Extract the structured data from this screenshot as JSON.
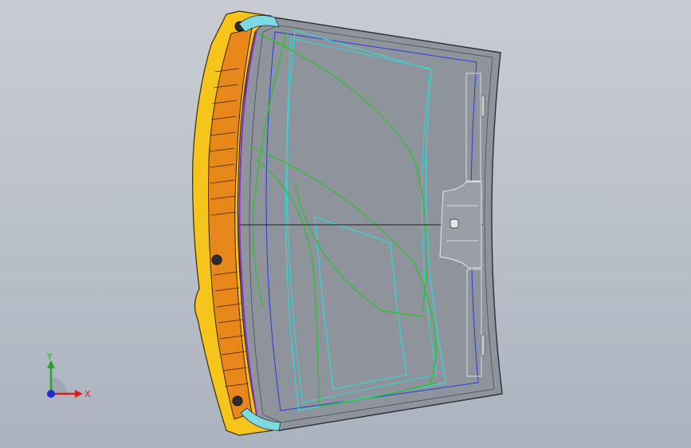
{
  "viewport": {
    "background_top": "#c9ccd2",
    "background_bottom": "#aab3bf"
  },
  "model": {
    "glass_fill": "#8f949c",
    "trim_color": "#f5c51b",
    "cowl_color": "#e8871a",
    "green_curve_color": "#29c229",
    "cyan_curve_color": "#31d8d8",
    "blue_curve_color": "#2a3ad6"
  },
  "triad": {
    "x_label": "X",
    "y_label": "Y",
    "x_color": "#d62020",
    "y_color": "#22a822",
    "z_color": "#1c2fd0"
  }
}
